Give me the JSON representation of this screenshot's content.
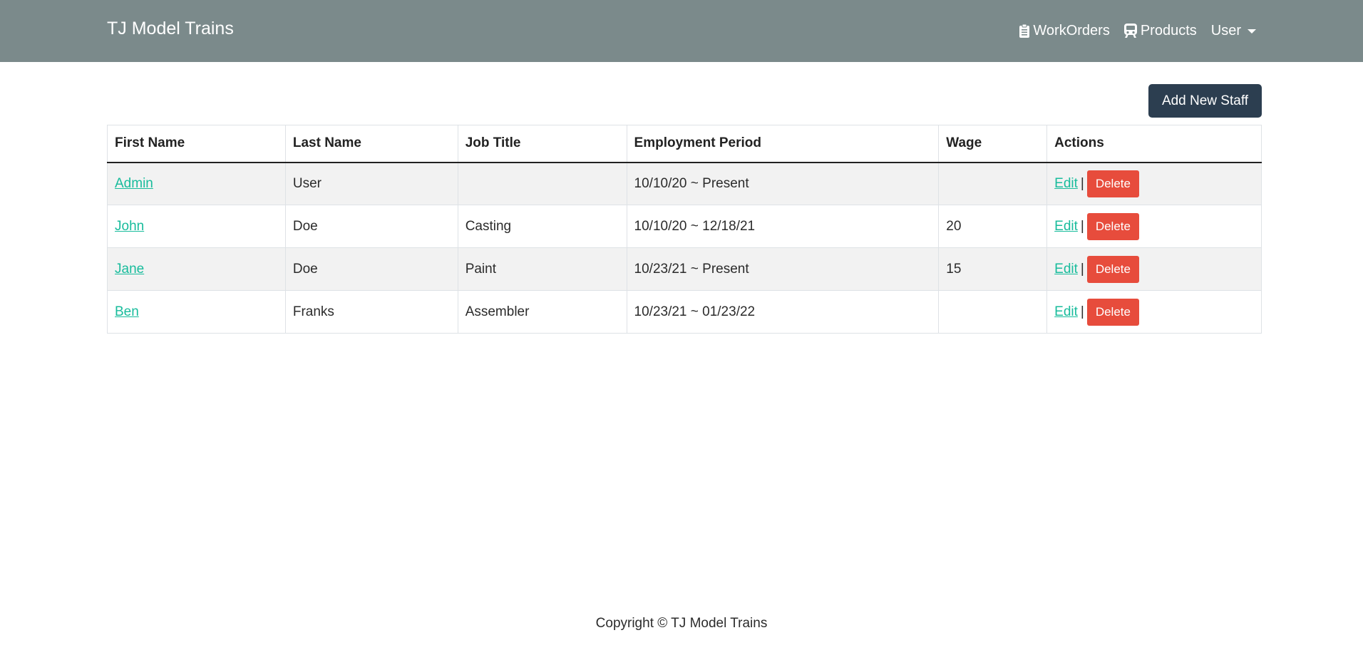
{
  "navbar": {
    "brand": "TJ Model Trains",
    "items": [
      {
        "label": "WorkOrders",
        "icon": "clipboard-icon"
      },
      {
        "label": "Products",
        "icon": "train-icon"
      },
      {
        "label": "User",
        "icon": "chevron-down-icon"
      }
    ]
  },
  "main": {
    "add_button": "Add New Staff",
    "table": {
      "headers": [
        "First Name",
        "Last Name",
        "Job Title",
        "Employment Period",
        "Wage",
        "Actions"
      ],
      "rows": [
        {
          "first": "Admin",
          "last": "User",
          "job": "",
          "period": "10/10/20 ~ Present",
          "wage": ""
        },
        {
          "first": "John",
          "last": "Doe",
          "job": "Casting",
          "period": "10/10/20 ~ 12/18/21",
          "wage": "20"
        },
        {
          "first": "Jane",
          "last": "Doe",
          "job": "Paint",
          "period": "10/23/21 ~ Present",
          "wage": "15"
        },
        {
          "first": "Ben",
          "last": "Franks",
          "job": "Assembler",
          "period": "10/23/21 ~ 01/23/22",
          "wage": ""
        }
      ],
      "edit_label": "Edit",
      "separator": "|",
      "delete_label": "Delete"
    }
  },
  "footer": {
    "text": "Copyright © TJ Model Trains"
  },
  "colors": {
    "navbar": "#7b8a8b",
    "primary": "#2c3e50",
    "link": "#18bc9c",
    "danger": "#e74c3c"
  }
}
